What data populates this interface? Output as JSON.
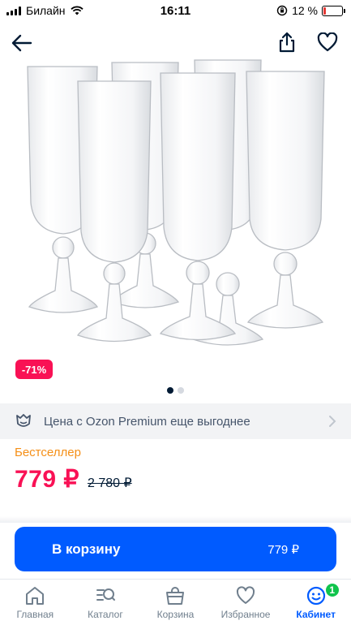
{
  "status_bar": {
    "carrier": "Билайн",
    "time": "16:11",
    "battery_percent": "12 %",
    "battery_level": 0.12
  },
  "topbar": {
    "back_icon": "arrow-left-icon",
    "share_icon": "share-icon",
    "favorite_icon": "heart-outline-icon"
  },
  "product": {
    "discount_badge": "-71%",
    "gallery_total": 2,
    "gallery_active_index": 0,
    "premium_text": "Цена с Ozon Premium еще выгоднее",
    "bestseller_label": "Бестселлер",
    "price": "779 ₽",
    "old_price": "2 780 ₽"
  },
  "cart_button": {
    "label": "В корзину",
    "price": "779 ₽"
  },
  "bottom_nav": [
    {
      "label": "Главная",
      "icon": "home-icon"
    },
    {
      "label": "Каталог",
      "icon": "catalog-search-icon"
    },
    {
      "label": "Корзина",
      "icon": "basket-icon"
    },
    {
      "label": "Избранное",
      "icon": "heart-icon"
    },
    {
      "label": "Кабинет",
      "icon": "profile-smile-icon",
      "badge": "1",
      "active": true
    }
  ],
  "colors": {
    "accent": "#005bff",
    "price": "#f91155",
    "bestseller": "#f58f17",
    "badge_green": "#10c44c"
  }
}
